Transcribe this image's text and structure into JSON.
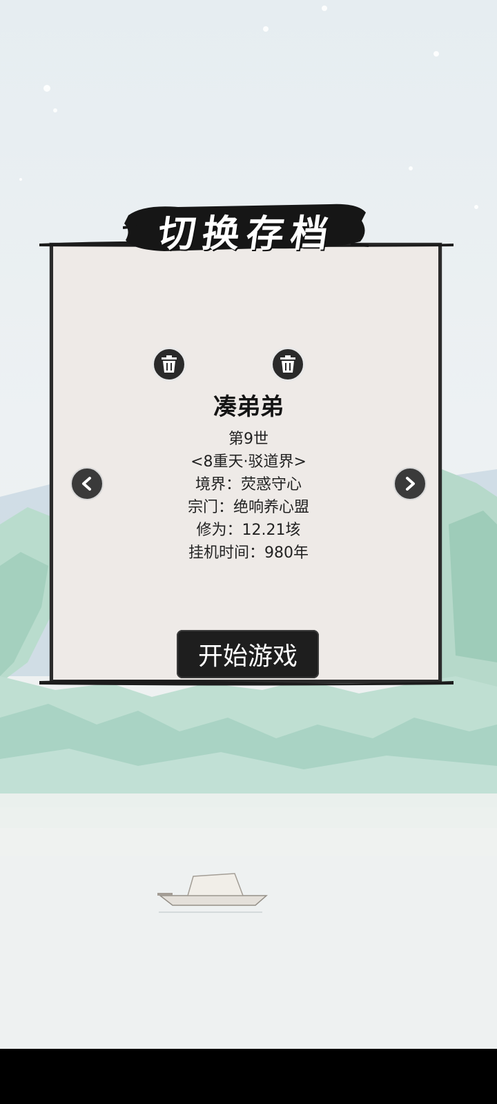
{
  "title": "切换存档",
  "slots": [
    {
      "state": "selected",
      "ring_color": "#b8403a"
    },
    {
      "state": "saved",
      "ring_color": "#3d3a38"
    },
    {
      "state": "empty",
      "ring_color": "#2f2f2f"
    }
  ],
  "character": {
    "name": "凑弟弟",
    "generation": "第9世",
    "heaven_level": "<8重天·驳道界>",
    "realm": "境界：荧惑守心",
    "sect": "宗门：绝响养心盟",
    "cultivation": "修为：12.21垓",
    "idle_time": "挂机时间：980年"
  },
  "buttons": {
    "start": "开始游戏"
  },
  "icons": {
    "trash": "trash-icon",
    "prev": "chevron-left-icon",
    "next": "chevron-right-icon",
    "unknown": "question-mark-icon"
  },
  "colors": {
    "panel_bg": "#eeeae7",
    "ink": "#1e1e1e",
    "mountain": "#a9d3c4"
  }
}
